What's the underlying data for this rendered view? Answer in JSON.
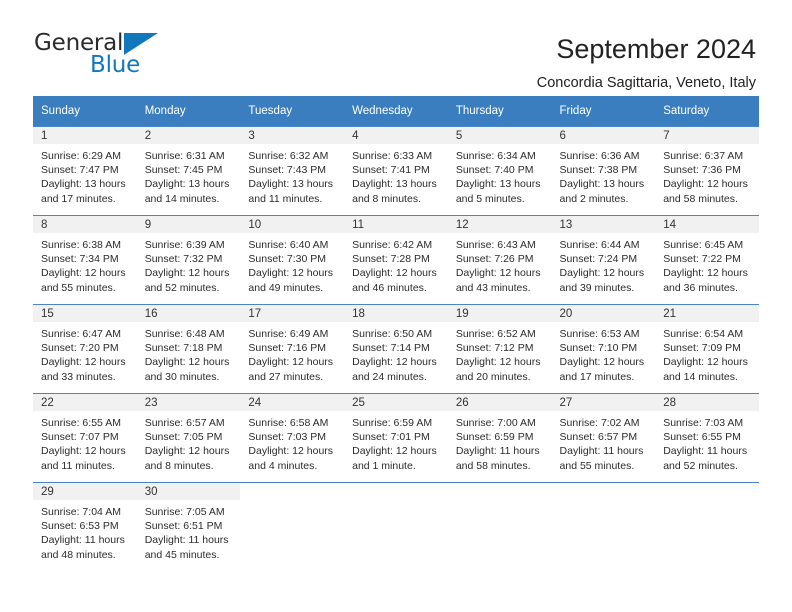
{
  "brand": {
    "name_top": "General",
    "name_bottom": "Blue",
    "accent_color": "#1278be"
  },
  "header": {
    "title": "September 2024",
    "subtitle": "Concordia Sagittaria, Veneto, Italy"
  },
  "theme": {
    "header_row_bg": "#3a7ec0",
    "daynum_band_bg": "#f1f1f1",
    "row_border": "#4a86c5"
  },
  "weekday_headers": [
    "Sunday",
    "Monday",
    "Tuesday",
    "Wednesday",
    "Thursday",
    "Friday",
    "Saturday"
  ],
  "days": [
    {
      "day": "1",
      "sunrise": "Sunrise: 6:29 AM",
      "sunset": "Sunset: 7:47 PM",
      "daylight": "Daylight: 13 hours and 17 minutes."
    },
    {
      "day": "2",
      "sunrise": "Sunrise: 6:31 AM",
      "sunset": "Sunset: 7:45 PM",
      "daylight": "Daylight: 13 hours and 14 minutes."
    },
    {
      "day": "3",
      "sunrise": "Sunrise: 6:32 AM",
      "sunset": "Sunset: 7:43 PM",
      "daylight": "Daylight: 13 hours and 11 minutes."
    },
    {
      "day": "4",
      "sunrise": "Sunrise: 6:33 AM",
      "sunset": "Sunset: 7:41 PM",
      "daylight": "Daylight: 13 hours and 8 minutes."
    },
    {
      "day": "5",
      "sunrise": "Sunrise: 6:34 AM",
      "sunset": "Sunset: 7:40 PM",
      "daylight": "Daylight: 13 hours and 5 minutes."
    },
    {
      "day": "6",
      "sunrise": "Sunrise: 6:36 AM",
      "sunset": "Sunset: 7:38 PM",
      "daylight": "Daylight: 13 hours and 2 minutes."
    },
    {
      "day": "7",
      "sunrise": "Sunrise: 6:37 AM",
      "sunset": "Sunset: 7:36 PM",
      "daylight": "Daylight: 12 hours and 58 minutes."
    },
    {
      "day": "8",
      "sunrise": "Sunrise: 6:38 AM",
      "sunset": "Sunset: 7:34 PM",
      "daylight": "Daylight: 12 hours and 55 minutes."
    },
    {
      "day": "9",
      "sunrise": "Sunrise: 6:39 AM",
      "sunset": "Sunset: 7:32 PM",
      "daylight": "Daylight: 12 hours and 52 minutes."
    },
    {
      "day": "10",
      "sunrise": "Sunrise: 6:40 AM",
      "sunset": "Sunset: 7:30 PM",
      "daylight": "Daylight: 12 hours and 49 minutes."
    },
    {
      "day": "11",
      "sunrise": "Sunrise: 6:42 AM",
      "sunset": "Sunset: 7:28 PM",
      "daylight": "Daylight: 12 hours and 46 minutes."
    },
    {
      "day": "12",
      "sunrise": "Sunrise: 6:43 AM",
      "sunset": "Sunset: 7:26 PM",
      "daylight": "Daylight: 12 hours and 43 minutes."
    },
    {
      "day": "13",
      "sunrise": "Sunrise: 6:44 AM",
      "sunset": "Sunset: 7:24 PM",
      "daylight": "Daylight: 12 hours and 39 minutes."
    },
    {
      "day": "14",
      "sunrise": "Sunrise: 6:45 AM",
      "sunset": "Sunset: 7:22 PM",
      "daylight": "Daylight: 12 hours and 36 minutes."
    },
    {
      "day": "15",
      "sunrise": "Sunrise: 6:47 AM",
      "sunset": "Sunset: 7:20 PM",
      "daylight": "Daylight: 12 hours and 33 minutes."
    },
    {
      "day": "16",
      "sunrise": "Sunrise: 6:48 AM",
      "sunset": "Sunset: 7:18 PM",
      "daylight": "Daylight: 12 hours and 30 minutes."
    },
    {
      "day": "17",
      "sunrise": "Sunrise: 6:49 AM",
      "sunset": "Sunset: 7:16 PM",
      "daylight": "Daylight: 12 hours and 27 minutes."
    },
    {
      "day": "18",
      "sunrise": "Sunrise: 6:50 AM",
      "sunset": "Sunset: 7:14 PM",
      "daylight": "Daylight: 12 hours and 24 minutes."
    },
    {
      "day": "19",
      "sunrise": "Sunrise: 6:52 AM",
      "sunset": "Sunset: 7:12 PM",
      "daylight": "Daylight: 12 hours and 20 minutes."
    },
    {
      "day": "20",
      "sunrise": "Sunrise: 6:53 AM",
      "sunset": "Sunset: 7:10 PM",
      "daylight": "Daylight: 12 hours and 17 minutes."
    },
    {
      "day": "21",
      "sunrise": "Sunrise: 6:54 AM",
      "sunset": "Sunset: 7:09 PM",
      "daylight": "Daylight: 12 hours and 14 minutes."
    },
    {
      "day": "22",
      "sunrise": "Sunrise: 6:55 AM",
      "sunset": "Sunset: 7:07 PM",
      "daylight": "Daylight: 12 hours and 11 minutes."
    },
    {
      "day": "23",
      "sunrise": "Sunrise: 6:57 AM",
      "sunset": "Sunset: 7:05 PM",
      "daylight": "Daylight: 12 hours and 8 minutes."
    },
    {
      "day": "24",
      "sunrise": "Sunrise: 6:58 AM",
      "sunset": "Sunset: 7:03 PM",
      "daylight": "Daylight: 12 hours and 4 minutes."
    },
    {
      "day": "25",
      "sunrise": "Sunrise: 6:59 AM",
      "sunset": "Sunset: 7:01 PM",
      "daylight": "Daylight: 12 hours and 1 minute."
    },
    {
      "day": "26",
      "sunrise": "Sunrise: 7:00 AM",
      "sunset": "Sunset: 6:59 PM",
      "daylight": "Daylight: 11 hours and 58 minutes."
    },
    {
      "day": "27",
      "sunrise": "Sunrise: 7:02 AM",
      "sunset": "Sunset: 6:57 PM",
      "daylight": "Daylight: 11 hours and 55 minutes."
    },
    {
      "day": "28",
      "sunrise": "Sunrise: 7:03 AM",
      "sunset": "Sunset: 6:55 PM",
      "daylight": "Daylight: 11 hours and 52 minutes."
    },
    {
      "day": "29",
      "sunrise": "Sunrise: 7:04 AM",
      "sunset": "Sunset: 6:53 PM",
      "daylight": "Daylight: 11 hours and 48 minutes."
    },
    {
      "day": "30",
      "sunrise": "Sunrise: 7:05 AM",
      "sunset": "Sunset: 6:51 PM",
      "daylight": "Daylight: 11 hours and 45 minutes."
    }
  ]
}
